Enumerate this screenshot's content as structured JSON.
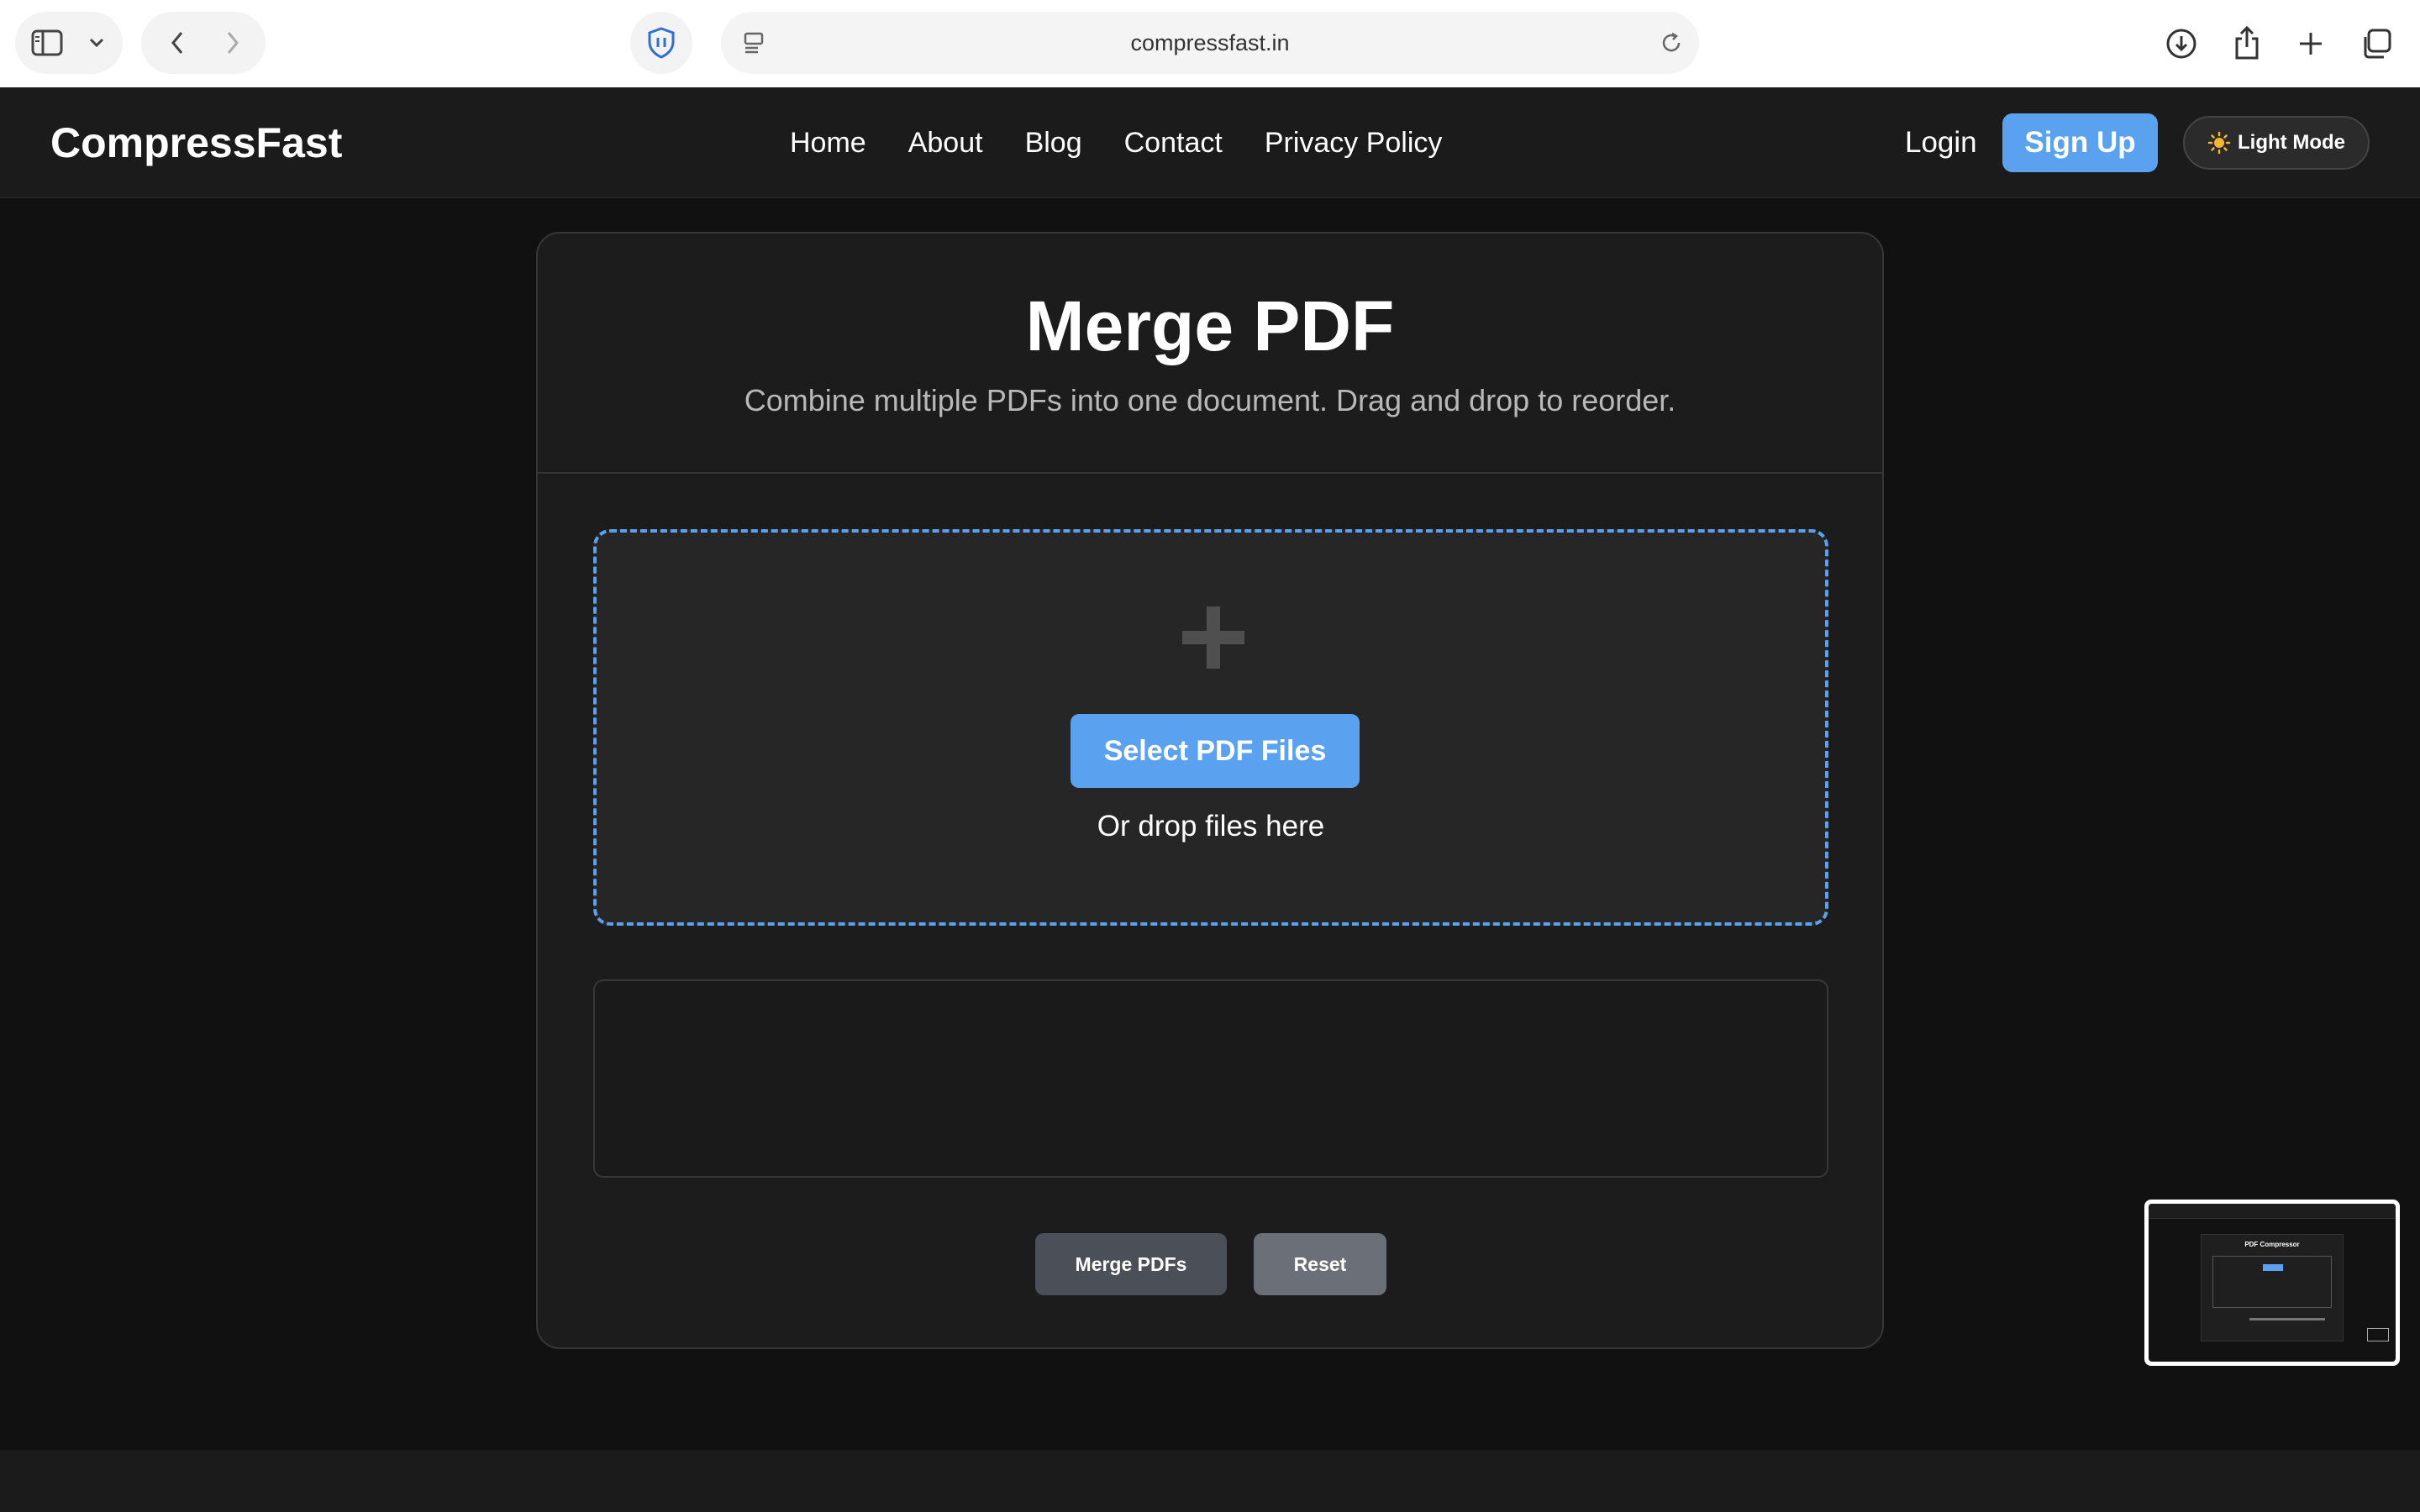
{
  "browser": {
    "url": "compressfast.in"
  },
  "nav": {
    "brand": "CompressFast",
    "links": [
      "Home",
      "About",
      "Blog",
      "Contact",
      "Privacy Policy"
    ],
    "login": "Login",
    "signup": "Sign Up",
    "mode_toggle": "Light Mode"
  },
  "tool": {
    "title": "Merge PDF",
    "subtitle": "Combine multiple PDFs into one document. Drag and drop to reorder.",
    "select_button": "Select PDF Files",
    "drop_hint": "Or drop files here",
    "merge_button": "Merge PDFs",
    "reset_button": "Reset"
  },
  "thumbnail": {
    "title": "PDF Compressor"
  },
  "colors": {
    "accent": "#5aa2f0",
    "background": "#111111",
    "card": "#1c1c1c"
  }
}
